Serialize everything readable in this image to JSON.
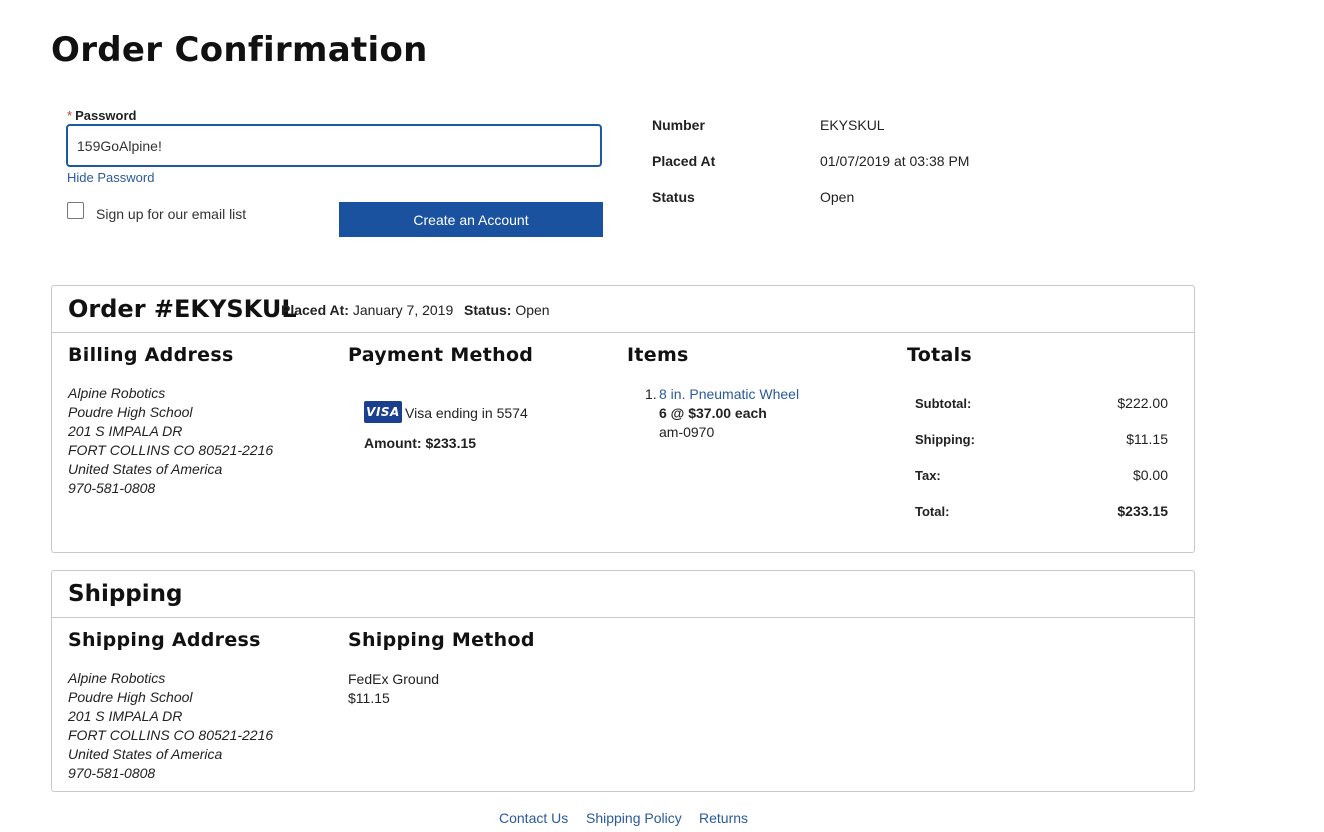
{
  "page": {
    "title": "Order Confirmation"
  },
  "account_form": {
    "password_label": "Password",
    "required_mark": "*",
    "password_value": "159GoAlpine!",
    "hide_password": "Hide Password",
    "email_signup_label": "Sign up for our email list",
    "email_signup_checked": false,
    "create_account_button": "Create an Account"
  },
  "order_info": {
    "number_label": "Number",
    "number_value": "EKYSKUL",
    "placed_label": "Placed At",
    "placed_value": "01/07/2019 at 03:38 PM",
    "status_label": "Status",
    "status_value": "Open"
  },
  "order_panel": {
    "title": "Order #EKYSKUL",
    "placed_label": "Placed At:",
    "placed_value": "January 7, 2019",
    "status_label": "Status:",
    "status_value": "Open",
    "billing": {
      "title": "Billing Address",
      "lines": [
        "Alpine Robotics",
        "Poudre High School",
        "201 S IMPALA DR",
        "FORT COLLINS CO 80521-2216",
        "United States of America",
        "970-581-0808"
      ]
    },
    "payment": {
      "title": "Payment Method",
      "card_brand": "VISA",
      "card_text": "Visa ending in 5574",
      "amount_label": "Amount:",
      "amount_value": "$233.15"
    },
    "items": {
      "title": "Items",
      "list": [
        {
          "index": "1.",
          "name": "8 in. Pneumatic Wheel",
          "qty_price": "6 @ $37.00 each",
          "sku": "am-0970"
        }
      ]
    },
    "totals": {
      "title": "Totals",
      "rows": [
        {
          "label": "Subtotal:",
          "value": "$222.00"
        },
        {
          "label": "Shipping:",
          "value": "$11.15"
        },
        {
          "label": "Tax:",
          "value": "$0.00"
        },
        {
          "label": "Total:",
          "value": "$233.15"
        }
      ]
    }
  },
  "shipping_panel": {
    "title": "Shipping",
    "address_title": "Shipping Address",
    "address_lines": [
      "Alpine Robotics",
      "Poudre High School",
      "201 S IMPALA DR",
      "FORT COLLINS CO 80521-2216",
      "United States of America",
      "970-581-0808"
    ],
    "method_title": "Shipping Method",
    "method_name": "FedEx Ground",
    "method_price": "$11.15"
  },
  "footer": {
    "links": [
      "Contact Us",
      "Shipping Policy",
      "Returns"
    ]
  },
  "colors": {
    "accent": "#1a52a0",
    "link": "#2a5a9c",
    "visa": "#1a3f8f",
    "required": "#c0392b"
  }
}
